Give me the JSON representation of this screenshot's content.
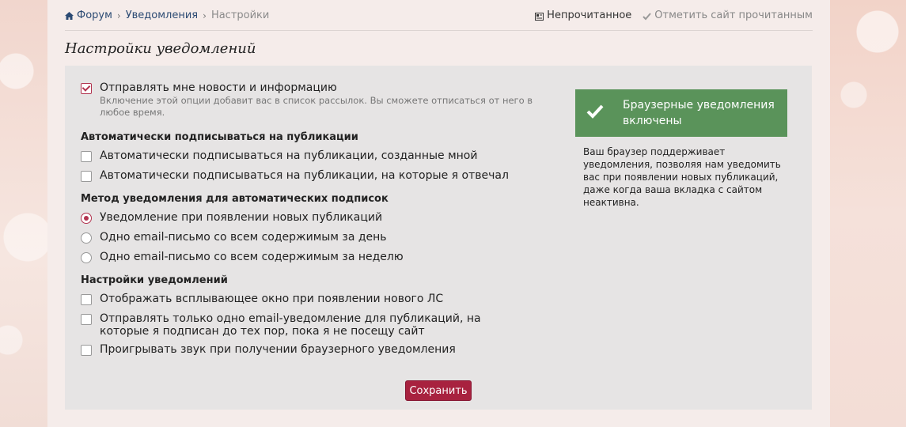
{
  "breadcrumb": {
    "items": [
      "Форум",
      "Уведомления"
    ],
    "current": "Настройки"
  },
  "top_actions": {
    "unread": "Непрочитанное",
    "mark_read": "Отметить сайт прочитанным"
  },
  "page_title": "Настройки уведомлений",
  "options": {
    "newsletter": {
      "label": "Отправлять мне новости и информацию",
      "hint": "Включение этой опции добавит вас в список рассылок. Вы сможете отписаться от него в любое время.",
      "checked": true
    },
    "auto_subscribe_heading": "Автоматически подписываться на публикации",
    "auto_subscribe": [
      {
        "label": "Автоматически подписываться на публикации, созданные мной",
        "checked": false
      },
      {
        "label": "Автоматически подписываться на публикации, на которые я отвечал",
        "checked": false
      }
    ],
    "method_heading": "Метод уведомления для автоматических подписок",
    "method": [
      {
        "label": "Уведомление при появлении новых публикаций",
        "checked": true
      },
      {
        "label": "Одно email-письмо со всем содержимым за день",
        "checked": false
      },
      {
        "label": "Одно email-письмо со всем содержимым за неделю",
        "checked": false
      }
    ],
    "notif_heading": "Настройки уведомлений",
    "notif": [
      {
        "label": "Отображать всплывающее окно при появлении нового ЛС",
        "checked": false
      },
      {
        "label": "Отправлять только одно email-уведомление для публикаций, на которые я подписан до тех пор, пока я не посещу сайт",
        "checked": false
      },
      {
        "label": "Проигрывать звук при получении браузерного уведомления",
        "checked": false
      }
    ]
  },
  "save_label": "Сохранить",
  "browser_notice": {
    "title": "Браузерные уведомления включены",
    "description": "Ваш браузер поддерживает уведомления, позволяя нам уведомить вас при появлении новых публикаций, даже когда ваша вкладка с сайтом неактивна."
  },
  "colors": {
    "accent": "#a8223f",
    "success": "#5a935a",
    "link": "#2b4a73"
  },
  "icons": [
    "home-icon",
    "unread-icon",
    "check-icon",
    "checkmark-icon"
  ]
}
